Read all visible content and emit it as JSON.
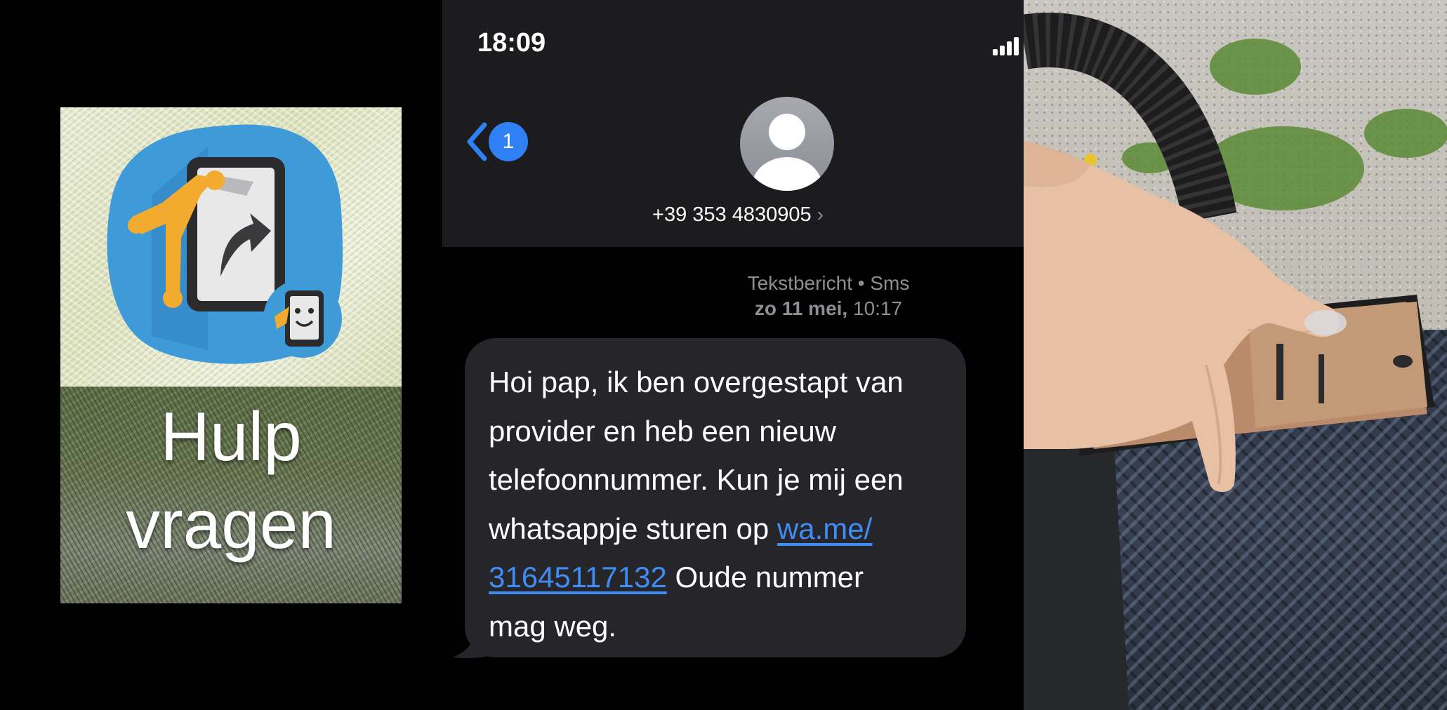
{
  "left_panel": {
    "app_label_line_1": "Hulp",
    "app_label_line_2": "vragen",
    "app_icon": "help-request-app-icon",
    "colors": {
      "icon_blob": "#3f9ad8",
      "arm": "#f2ab2e"
    }
  },
  "phone": {
    "status_bar": {
      "time": "18:09",
      "signal_icon": "cellular-signal-icon"
    },
    "nav": {
      "back_icon": "chevron-left-icon",
      "unread_count": "1"
    },
    "contact": {
      "number": "+39 353 4830905",
      "chevron": "›",
      "avatar_icon": "person-silhouette-icon"
    },
    "message_meta": {
      "type": "Tekstbericht • Sms",
      "date": "zo 11 mei,",
      "time": "10:17"
    },
    "message": {
      "line_1": "Hoi pap, ik ben overgestapt van",
      "line_2": "provider en heb een nieuw",
      "line_3": "telefoonnummer. Kun je mij een",
      "line_4_text": "whatsappje sturen op ",
      "link_part_1": "wa.me/",
      "link_part_2": "31645117132",
      "line_5_text": " Oude nummer",
      "line_6": "mag weg."
    },
    "colors": {
      "header_bg": "#1c1c1e",
      "bubble_bg": "#26262a",
      "link": "#3f8cf5",
      "badge": "#2f7ff5",
      "meta_text": "#8e8e93"
    }
  },
  "right_photo": {
    "description_icon": "hand-holding-phone-photo"
  }
}
